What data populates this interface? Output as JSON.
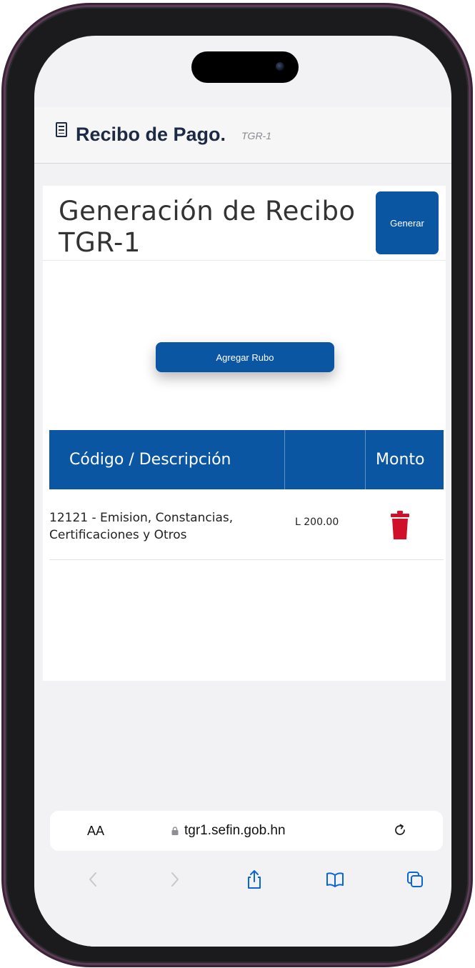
{
  "app": {
    "title": "Recibo de Pago.",
    "tag": "TGR-1"
  },
  "page": {
    "title": "Generación de Recibo TGR-1",
    "generate_button": "Generar",
    "add_item_button": "Agregar Rubo"
  },
  "table": {
    "headers": [
      "Código / Descripción",
      "",
      "Monto"
    ],
    "rows": [
      {
        "description": "12121 - Emision, Constancias, Certificaciones y Otros",
        "amount": "L 200.00",
        "action_icon": "trash-icon"
      }
    ]
  },
  "browser": {
    "text_size_label": "AA",
    "url": "tgr1.sefin.gob.hn",
    "icons": [
      "lock-icon",
      "reload-icon",
      "back-icon",
      "forward-icon",
      "share-icon",
      "bookmarks-icon",
      "tabs-icon"
    ]
  },
  "colors": {
    "primary": "#0b56a3",
    "delete": "#d0102a",
    "header_text": "#1d2a44",
    "phone_frame": "#5d3c57"
  }
}
